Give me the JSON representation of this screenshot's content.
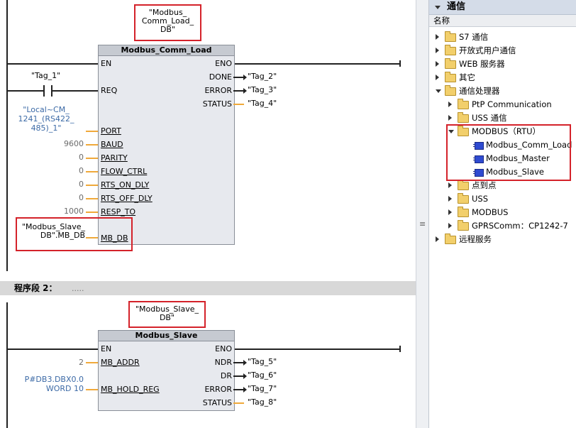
{
  "network1": {
    "instance_db": "\"Modbus_\nComm_Load_\nDB\"",
    "block_title": "Modbus_Comm_Load",
    "en": "EN",
    "eno": "ENO",
    "done": "DONE",
    "error": "ERROR",
    "status": "STATUS",
    "req": "REQ",
    "port": "PORT",
    "baud": "BAUD",
    "parity": "PARITY",
    "flow_ctrl": "FLOW_CTRL",
    "rts_on_dly": "RTS_ON_DLY",
    "rts_off_dly": "RTS_OFF_DLY",
    "resp_to": "RESP_TO",
    "mb_db": "MB_DB",
    "tag_1": "\"Tag_1\"",
    "port_val": "\"Local~CM_\n1241_(RS422_\n485)_1\"",
    "baud_val": "9600",
    "parity_val": "0",
    "flow_val": "0",
    "rts_on_val": "0",
    "rts_off_val": "0",
    "resp_to_val": "1000",
    "mb_db_val": "\"Modbus_Slave_\nDB\".MB_DB",
    "tag_2": "\"Tag_2\"",
    "tag_3": "\"Tag_3\"",
    "tag_4": "\"Tag_4\""
  },
  "network2": {
    "header": "程序段 2：",
    "comment": ".....",
    "instance_db": "\"Modbus_Slave_\nDB\"",
    "block_title": "Modbus_Slave",
    "en": "EN",
    "eno": "ENO",
    "mb_addr": "MB_ADDR",
    "mb_hold_reg": "MB_HOLD_REG",
    "ndr": "NDR",
    "dr": "DR",
    "error": "ERROR",
    "status": "STATUS",
    "mb_addr_val": "2",
    "hold_reg_val": "P#DB3.DBX0.0\nWORD 10",
    "tag_5": "\"Tag_5\"",
    "tag_6": "\"Tag_6\"",
    "tag_7": "\"Tag_7\"",
    "tag_8": "\"Tag_8\""
  },
  "splitter": {
    "grip": "≡"
  },
  "tree": {
    "title": "通信",
    "column": "名称",
    "items": [
      {
        "label": "S7 通信",
        "icon": "folder-icon",
        "expander": "collapsed"
      },
      {
        "label": "开放式用户通信",
        "icon": "folder-icon",
        "expander": "collapsed"
      },
      {
        "label": "WEB 服务器",
        "icon": "folder-icon",
        "expander": "collapsed"
      },
      {
        "label": "其它",
        "icon": "folder-icon",
        "expander": "collapsed"
      },
      {
        "label": "通信处理器",
        "icon": "folder-icon",
        "expander": "expanded"
      },
      {
        "label": "PtP Communication",
        "icon": "folder-icon",
        "expander": "collapsed"
      },
      {
        "label": "USS 通信",
        "icon": "folder-icon",
        "expander": "collapsed"
      },
      {
        "label": "MODBUS（RTU）",
        "icon": "folder-icon",
        "expander": "expanded"
      },
      {
        "label": "Modbus_Comm_Load",
        "icon": "function-block-icon",
        "expander": "none"
      },
      {
        "label": "Modbus_Master",
        "icon": "function-block-icon",
        "expander": "none"
      },
      {
        "label": "Modbus_Slave",
        "icon": "function-block-icon",
        "expander": "none"
      },
      {
        "label": "点到点",
        "icon": "folder-icon",
        "expander": "collapsed"
      },
      {
        "label": "USS",
        "icon": "folder-icon",
        "expander": "collapsed"
      },
      {
        "label": "MODBUS",
        "icon": "folder-icon",
        "expander": "collapsed"
      },
      {
        "label": "GPRSComm：CP1242-7",
        "icon": "folder-icon",
        "expander": "collapsed"
      },
      {
        "label": "远程服务",
        "icon": "folder-icon",
        "expander": "collapsed"
      }
    ]
  },
  "colors": {
    "highlight": "#d4222a",
    "wire_param": "#f0a93a",
    "param_value": "#3c6aa6"
  }
}
